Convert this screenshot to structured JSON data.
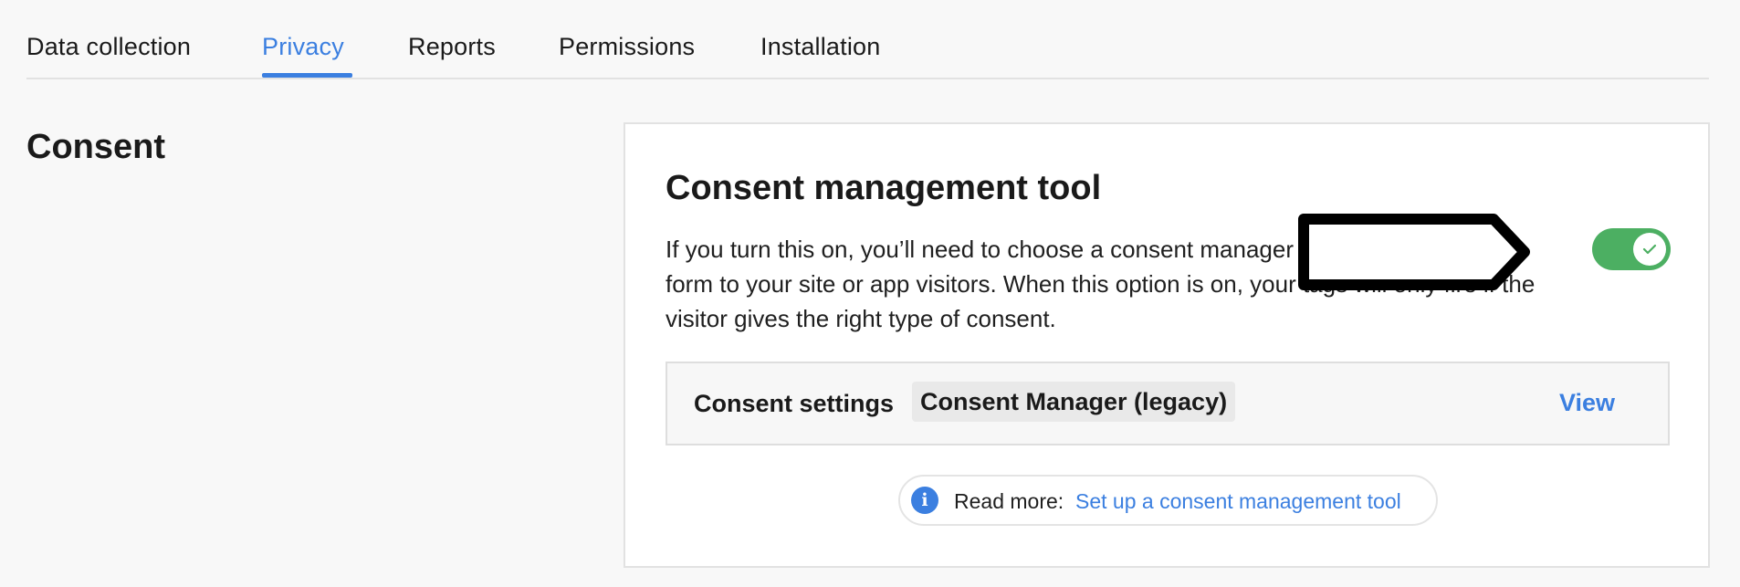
{
  "tabs": [
    {
      "label": "Data collection"
    },
    {
      "label": "Privacy",
      "active": true
    },
    {
      "label": "Reports"
    },
    {
      "label": "Permissions"
    },
    {
      "label": "Installation"
    }
  ],
  "section": {
    "title": "Consent"
  },
  "card": {
    "title": "Consent management tool",
    "description": "If you turn this on, you’ll need to choose a consent manager that shows a consent form to your site or app visitors. When this option is on, your tags will only fire if the visitor gives the right type of consent.",
    "toggle": {
      "on": true,
      "icon": "check-icon"
    },
    "settings": {
      "label": "Consent settings",
      "value": "Consent Manager (legacy)",
      "action": "View"
    },
    "read_more": {
      "label": "Read more:",
      "link": "Set up a consent management tool",
      "icon": "info-icon"
    }
  },
  "colors": {
    "accent": "#3b7fe0",
    "toggle_on": "#4caf62",
    "background": "#f8f8f8"
  }
}
